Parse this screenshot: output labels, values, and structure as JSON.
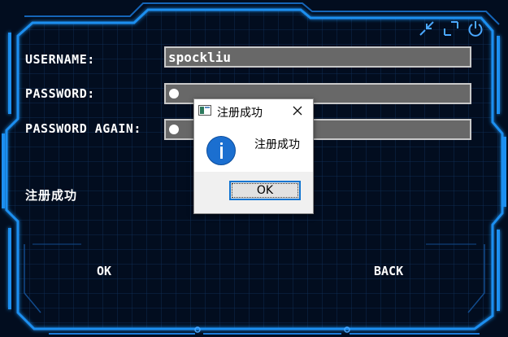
{
  "form": {
    "username_label": "USERNAME:",
    "username_value": "spockliu",
    "password_label": "PASSWORD:",
    "password_again_label": "PASSWORD AGAIN:",
    "status_text": "注册成功"
  },
  "actions": {
    "ok_label": "OK",
    "back_label": "BACK"
  },
  "window_controls": [
    "minimize-icon",
    "maximize-icon",
    "power-icon"
  ],
  "dialog": {
    "title": "注册成功",
    "message": "注册成功",
    "ok_label": "OK",
    "icon": "info-icon"
  },
  "colors": {
    "background": "#020d1f",
    "frame_glow": "#1e8ff0",
    "input_bg": "#686868",
    "dialog_accent": "#0f74d1"
  }
}
